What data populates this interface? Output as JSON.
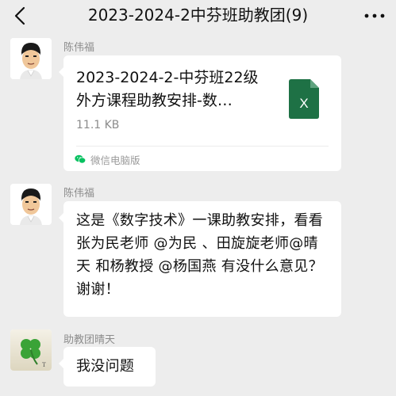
{
  "header": {
    "title": "2023-2024-2中芬班助教团(9)",
    "back_icon": "chevron-left-icon",
    "more_icon": "more-dots-icon"
  },
  "messages": [
    {
      "sender": "陈伟福",
      "type": "file",
      "file": {
        "name": "2023-2024-2-中芬班22级外方课程助教安排-数…",
        "size": "11.1 KB",
        "icon": "excel-file-icon",
        "icon_letter": "X",
        "icon_color": "#1e7145"
      },
      "source": {
        "icon": "wechat-icon",
        "label": "微信电脑版"
      }
    },
    {
      "sender": "陈伟福",
      "type": "text",
      "text": "这是《数字技术》一课助教安排，看看张为民老师 @为民 、田旋旋老师@晴天  和杨教授 @杨国燕  有没什么意见？谢谢！"
    },
    {
      "sender": "助教团晴天",
      "type": "text",
      "text": "我没问题"
    }
  ],
  "colors": {
    "background": "#ededed",
    "bubble": "#ffffff",
    "sender_text": "#8c8c8c",
    "excel_green": "#1e7145",
    "wechat_green": "#07c160"
  }
}
